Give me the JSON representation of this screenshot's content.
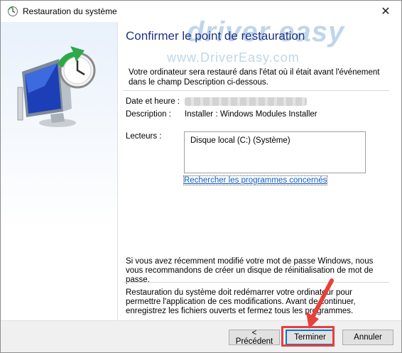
{
  "window": {
    "title": "Restauration du système",
    "close_glyph": "✕"
  },
  "watermark": {
    "brand": "driver easy",
    "url": "www.DriverEasy.com"
  },
  "main": {
    "heading": "Confirmer le point de restauration",
    "intro": "Votre ordinateur sera restauré dans l'état où il était avant l'événement dans le champ Description ci-dessous.",
    "date_label": "Date et heure :",
    "description_label": "Description :",
    "description_value": "Installer : Windows Modules Installer",
    "drives_label": "Lecteurs :",
    "drives": [
      "Disque local (C:) (Système)"
    ],
    "link": "Rechercher les programmes concernés",
    "password_note": "Si vous avez récemment modifié votre mot de passe Windows, nous vous recommandons de créer un disque de réinitialisation de mot de passe.",
    "restart_note": "Restauration du système doit redémarrer votre ordinateur pour permettre l'application de ces modifications. Avant de continuer, enregistrez les fichiers ouverts et fermez tous les programmes."
  },
  "buttons": {
    "back": "< Précédent",
    "finish": "Terminer",
    "cancel": "Annuler"
  },
  "colors": {
    "heading": "#1e3287",
    "link": "#0b5cc5",
    "annotation": "#e8403a",
    "focus_border": "#0078d7"
  },
  "icons": {
    "app": "system-restore-icon",
    "hero": "system-restore-monitor-clock-icon"
  }
}
